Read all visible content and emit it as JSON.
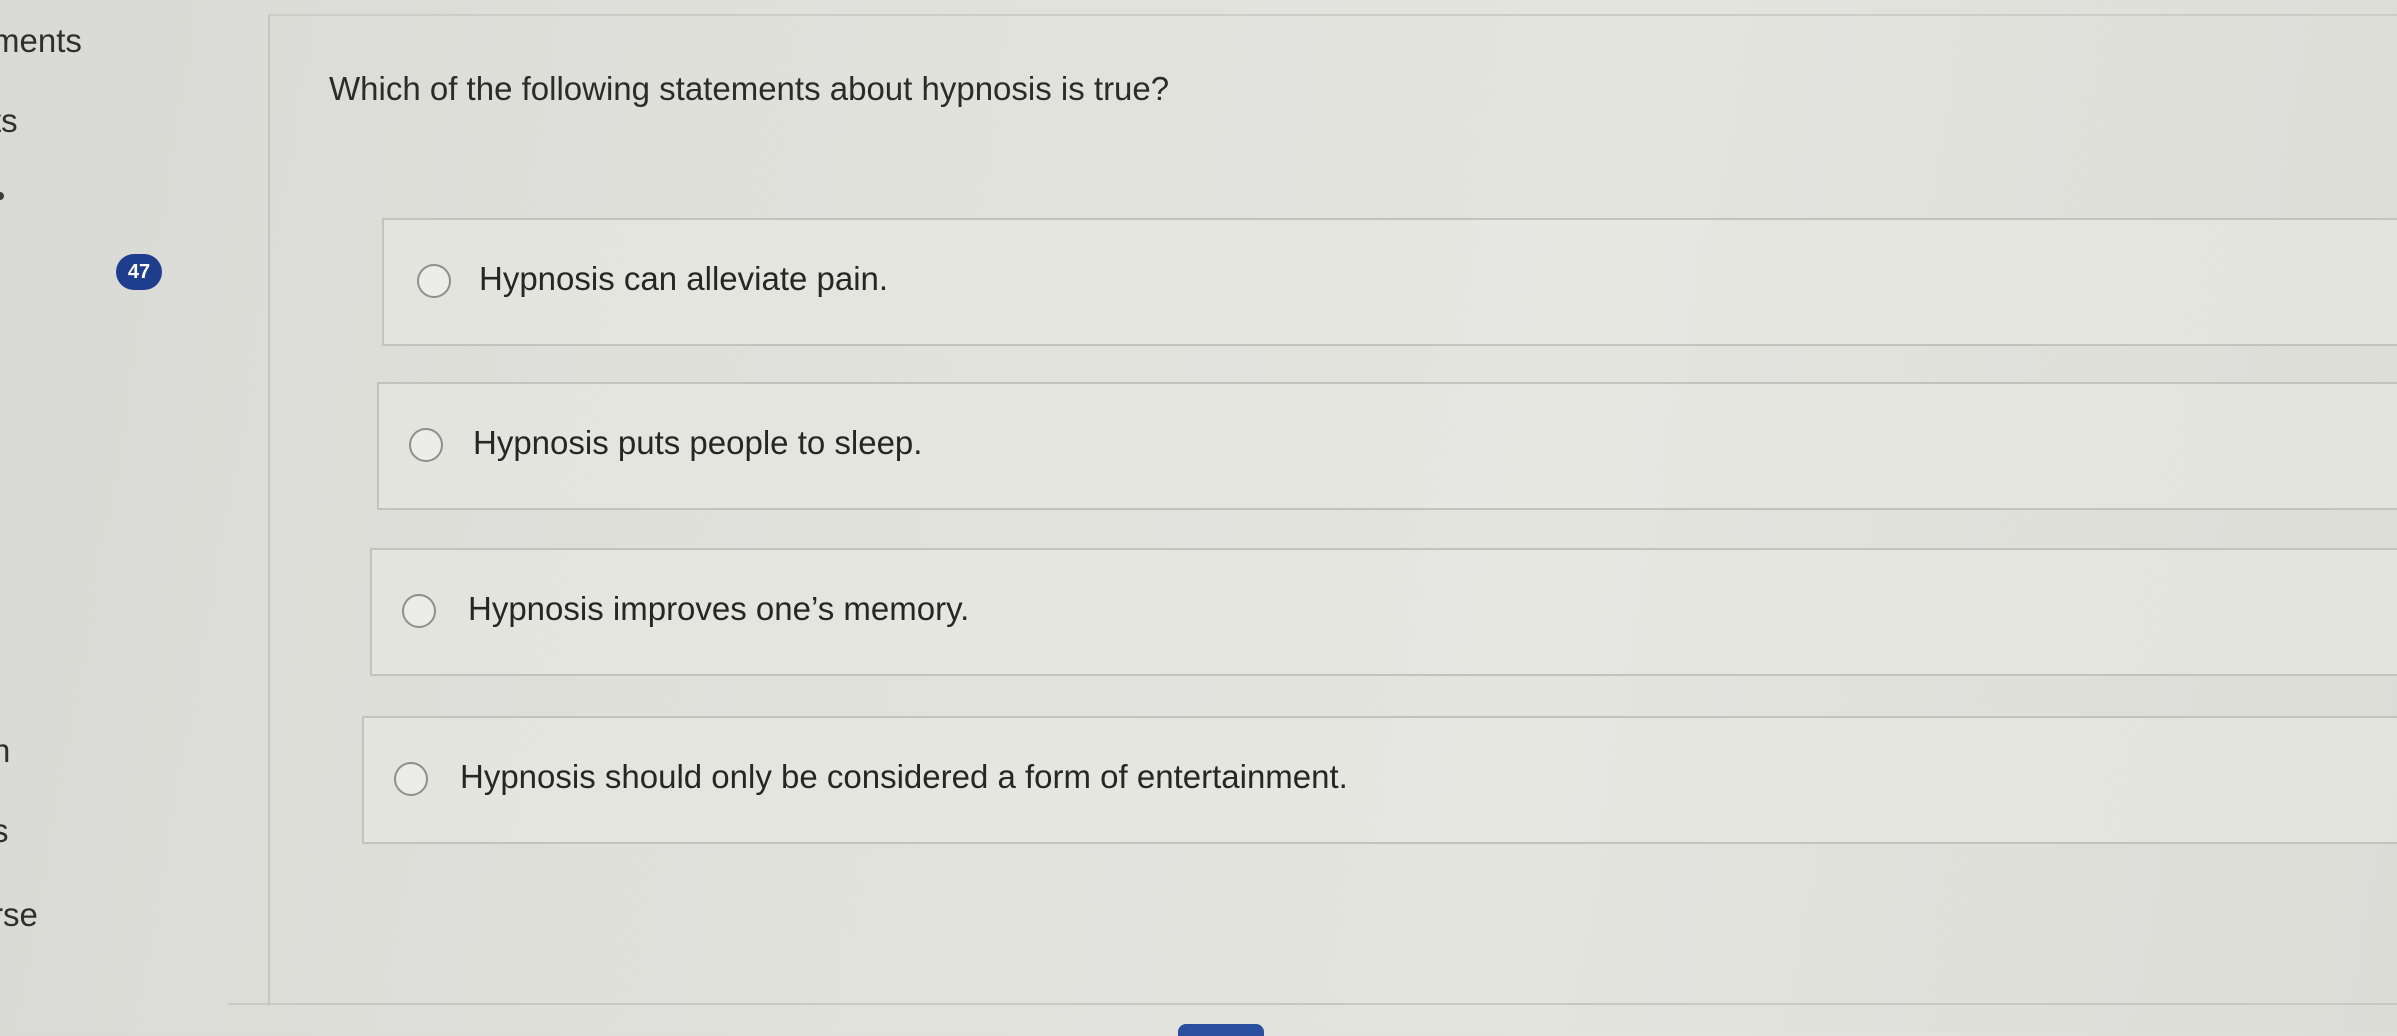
{
  "nav": {
    "items": [
      "ments",
      "ts",
      "n",
      "s",
      "rse"
    ]
  },
  "question": {
    "number": "47",
    "text": "Which of the following statements about hypnosis is true?",
    "options": [
      "Hypnosis can alleviate pain.",
      "Hypnosis puts people to sleep.",
      "Hypnosis improves one’s memory.",
      "Hypnosis should only be considered a form of entertainment."
    ]
  },
  "colors": {
    "badge": "#1e3d8c",
    "background": "#e1e1dc",
    "border": "#c3c3be"
  }
}
